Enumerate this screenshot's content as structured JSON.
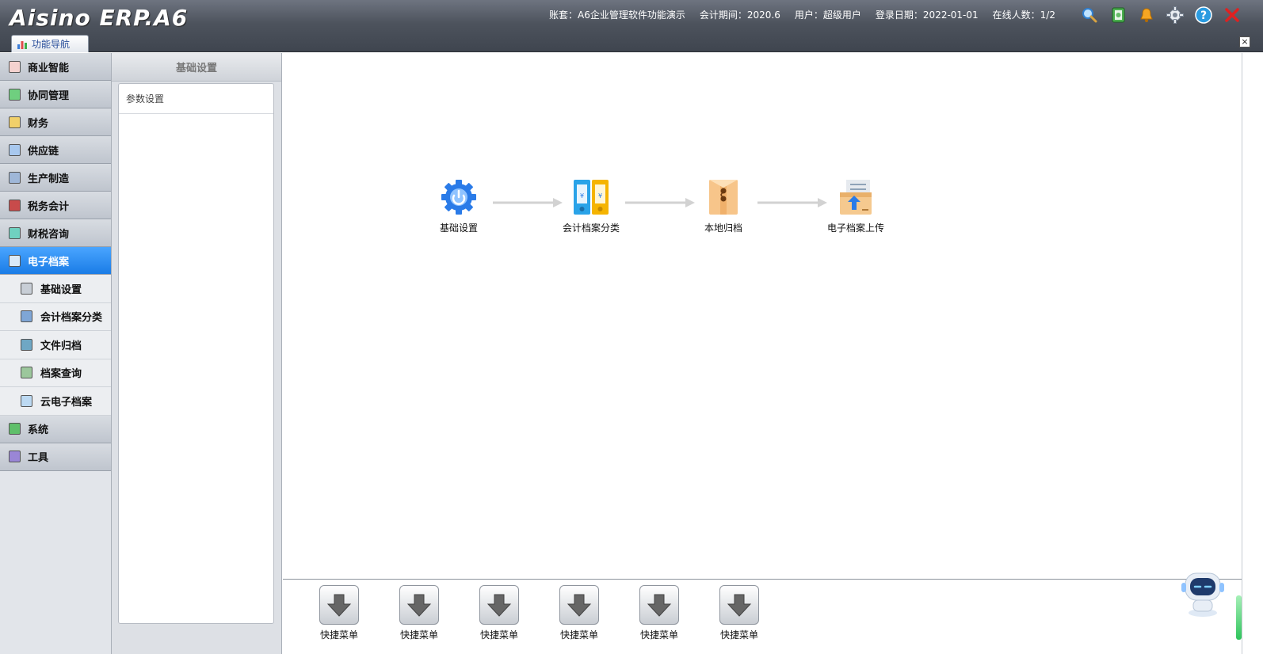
{
  "app": {
    "logo_text": "Aisino ERP.A6",
    "info": {
      "account": "账套：A6企业管理软件功能演示",
      "period": "会计期间：2020.6",
      "user": "用户：超级用户",
      "login_date": "登录日期：2022-01-01",
      "online": "在线人数：1/2"
    },
    "tab_label": "功能导航"
  },
  "left_menu": {
    "items": [
      {
        "label": "商业智能",
        "icon": "bi-icon",
        "color": "#c0392b"
      },
      {
        "label": "协同管理",
        "icon": "collab-icon",
        "color": "#1e8a3a"
      },
      {
        "label": "财务",
        "icon": "finance-icon",
        "color": "#d4a017"
      },
      {
        "label": "供应链",
        "icon": "supply-chain-icon",
        "color": "#2f6fb3"
      },
      {
        "label": "生产制造",
        "icon": "manufacturing-icon",
        "color": "#4a6fa5"
      },
      {
        "label": "税务会计",
        "icon": "tax-icon",
        "color": "#8b1a1a"
      },
      {
        "label": "财税咨询",
        "icon": "consult-icon",
        "color": "#1a8a7a"
      },
      {
        "label": "电子档案",
        "icon": "e-archive-icon",
        "color": "#3a8fd9",
        "active": true
      },
      {
        "label": "系统",
        "icon": "system-icon",
        "color": "#2e7d32"
      },
      {
        "label": "工具",
        "icon": "tools-icon",
        "color": "#5c3fa3"
      }
    ],
    "sub_items": [
      {
        "label": "基础设置",
        "icon": "basic-settings-icon",
        "color": "#7a8a9a"
      },
      {
        "label": "会计档案分类",
        "icon": "archive-category-icon",
        "color": "#2f6fb3"
      },
      {
        "label": "文件归档",
        "icon": "file-archive-icon",
        "color": "#2f7fa3"
      },
      {
        "label": "档案查询",
        "icon": "archive-query-icon",
        "color": "#3f7f3f"
      },
      {
        "label": "云电子档案",
        "icon": "cloud-archive-icon",
        "color": "#5fa3d9"
      }
    ]
  },
  "sub_panel": {
    "title": "基础设置",
    "items": [
      "参数设置"
    ]
  },
  "flow": {
    "nodes": [
      {
        "label": "基础设置",
        "icon": "gear-icon"
      },
      {
        "label": "会计档案分类",
        "icon": "binders-icon"
      },
      {
        "label": "本地归档",
        "icon": "envelope-icon"
      },
      {
        "label": "电子档案上传",
        "icon": "upload-box-icon"
      }
    ]
  },
  "shortcuts": {
    "label": "快捷菜单",
    "count": 6
  },
  "colors": {
    "titlebar": "#4d535d",
    "active_menu": "#1a7ce6",
    "close_red": "#e02020"
  }
}
